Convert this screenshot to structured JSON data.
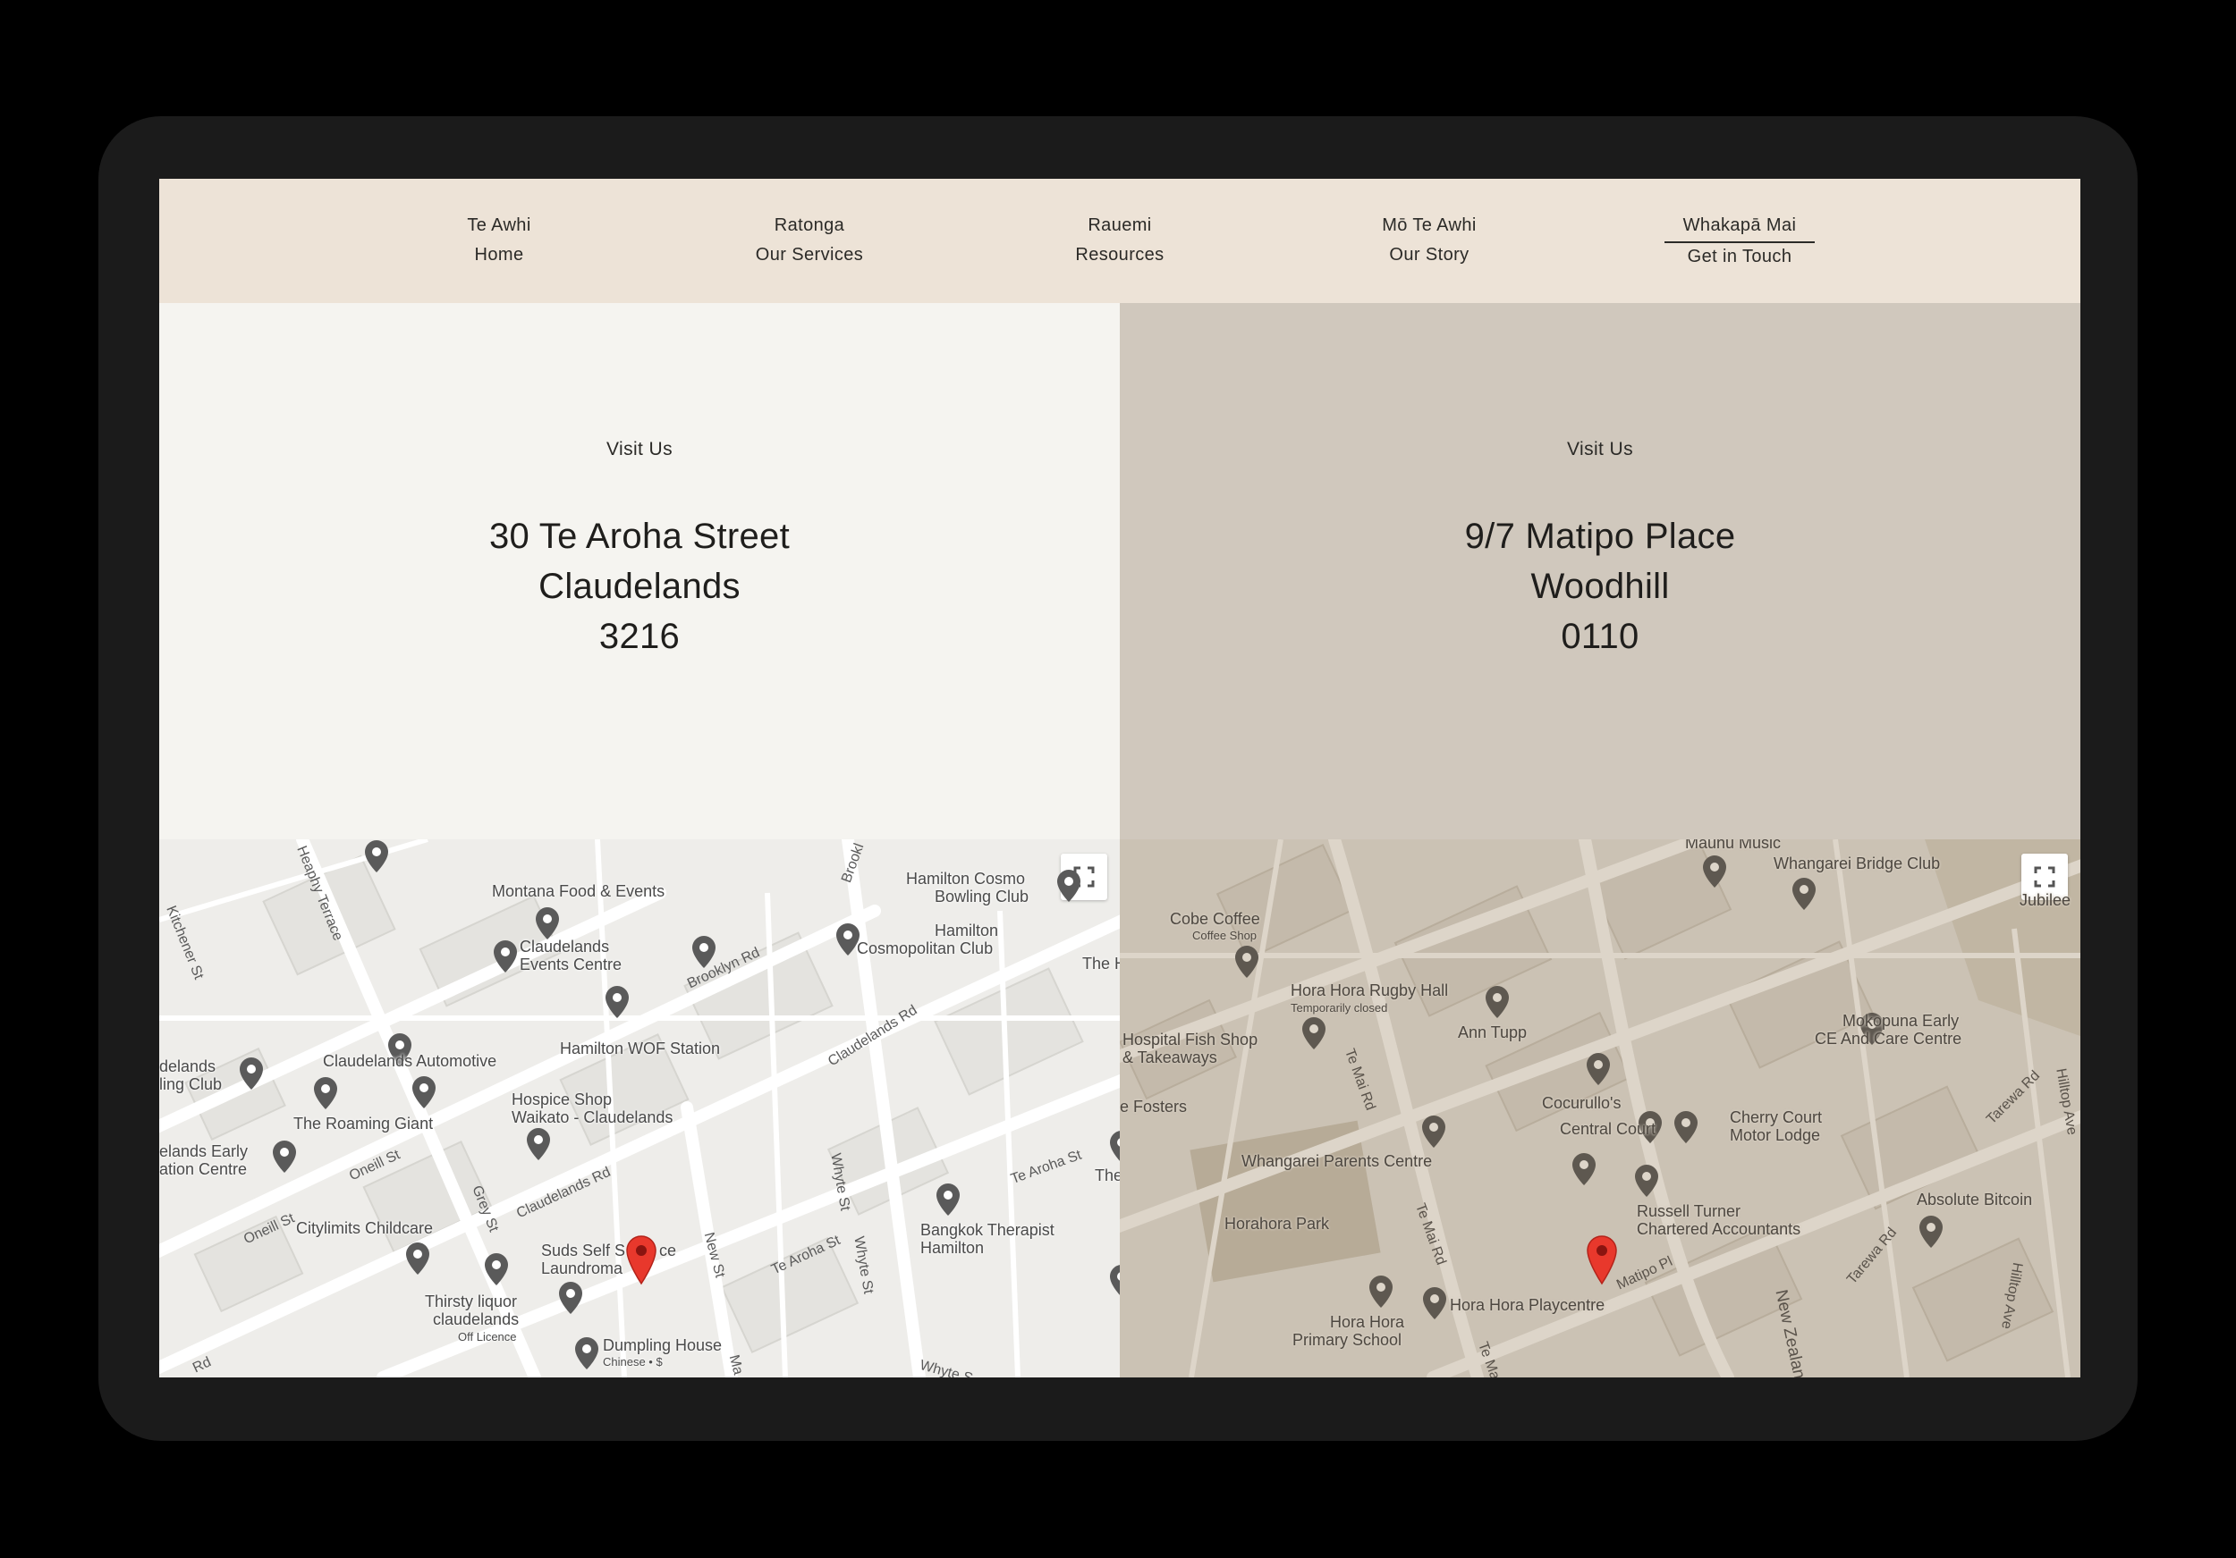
{
  "nav": {
    "items": [
      {
        "maori": "Te Awhi",
        "english": "Home"
      },
      {
        "maori": "Ratonga",
        "english": "Our Services"
      },
      {
        "maori": "Rauemi",
        "english": "Resources"
      },
      {
        "maori": "Mō Te Awhi",
        "english": "Our Story"
      },
      {
        "maori": "Whakapā Mai",
        "english": "Get in Touch"
      }
    ],
    "active_index": 4
  },
  "locations": [
    {
      "heading": "Visit Us",
      "address_line1": "30 Te Aroha Street",
      "address_line2": "Claudelands",
      "address_line3": "3216",
      "map": {
        "places": {
          "montana": "Montana Food & Events",
          "claudelands_events_1": "Claudelands",
          "claudelands_events_2": "Events Centre",
          "hamilton_cosmo_1": "Hamilton Cosmo",
          "hamilton_cosmo_2": "Bowling Club",
          "hamilton_cosmopolitan_1": "Hamilton",
          "hamilton_cosmopolitan_2": "Cosmopolitan Club",
          "the_h": "The H",
          "delands_1": "delands",
          "delands_2": "ling Club",
          "claudelands_automotive": "Claudelands Automotive",
          "hamilton_wof": "Hamilton WOF Station",
          "hospice_1": "Hospice Shop",
          "hospice_2": "Waikato - Claudelands",
          "roaming_giant": "The Roaming Giant",
          "elands_early_1": "elands Early",
          "elands_early_2": "ation Centre",
          "citylimits": "Citylimits Childcare",
          "suds_1": "Suds Self S",
          "suds_2": "Laundroma",
          "suds_3": "ce",
          "thirsty_1": "Thirsty liquor",
          "thirsty_2": "claudelands",
          "thirsty_sub": "Off Licence",
          "bangkok_1": "Bangkok Therapist",
          "bangkok_2": "Hamilton",
          "the": "The",
          "dumpling": "Dumpling House",
          "dumpling_sub": "Chinese • $"
        },
        "streets": {
          "heaphy": "Heaphy Terrace",
          "kitchener": "Kitchener St",
          "brooklyn": "Brooklyn Rd",
          "brookl": "Brookl",
          "claudelands_rd_1": "Claudelands Rd",
          "claudelands_rd_2": "Claudelands Rd",
          "oneill_1": "Oneill St",
          "oneill_2": "Oneill St",
          "grey": "Grey St",
          "new_st": "New St",
          "whyte_1": "Whyte St",
          "whyte_2": "Whyte St",
          "whyte_3": "Whyte S",
          "te_aroha_1": "Te Aroha St",
          "te_aroha_2": "Te Aroha St",
          "rd": "Rd",
          "ma": "Ma"
        }
      }
    },
    {
      "heading": "Visit Us",
      "address_line1": "9/7 Matipo Place",
      "address_line2": "Woodhill",
      "address_line3": "0110",
      "map": {
        "places": {
          "maunu_music": "Maunu Music",
          "whangarei_bridge": "Whangarei Bridge Club",
          "jubilee": "Jubilee",
          "cobe_coffee": "Cobe Coffee",
          "cobe_sub": "Coffee Shop",
          "hora_rugby": "Hora Hora Rugby Hall",
          "hora_rugby_sub": "Temporarily closed",
          "ann_tupp": "Ann Tupp",
          "hospital_fish_1": "Hospital Fish Shop",
          "hospital_fish_2": "& Takeaways",
          "mokopuna_1": "Mokopuna Early",
          "mokopuna_2": "CE And Care Centre",
          "fosters": "e Fosters",
          "cocurullos": "Cocurullo's",
          "central_court": "Central Court",
          "cherry_1": "Cherry Court",
          "cherry_2": "Motor Lodge",
          "whangarei_parents": "Whangarei Parents Centre",
          "horahora_park": "Horahora Park",
          "russell_1": "Russell Turner",
          "russell_2": "Chartered Accountants",
          "absolute_bitcoin": "Absolute Bitcoin",
          "hora_primary_1": "Hora Hora",
          "hora_primary_2": "Primary School",
          "hora_playcentre": "Hora Hora Playcentre"
        },
        "streets": {
          "te_mai_1": "Te Mai Rd",
          "te_mai_2": "Te Mai Rd",
          "te_ma": "Te Ma",
          "matipo": "Matipo Pl",
          "tarewa_1": "Tarewa Rd",
          "tarewa_2": "Tarewa Rd",
          "hilltop_1": "Hilltop Ave",
          "hilltop_2": "Hilltop Ave",
          "new_zealand": "New Zealan"
        }
      }
    }
  ],
  "colors": {
    "nav_bg": "#ede3d7",
    "panel_left_bg": "#f5f4f0",
    "panel_right_bg": "#d0c8bd",
    "marker_red": "#e8382c",
    "device_frame": "#1b1b1b"
  },
  "icons": [
    "fullscreen-icon",
    "map-pin-icon",
    "location-marker-icon",
    "restaurant-icon",
    "shopping-icon",
    "school-icon",
    "lodging-icon"
  ]
}
